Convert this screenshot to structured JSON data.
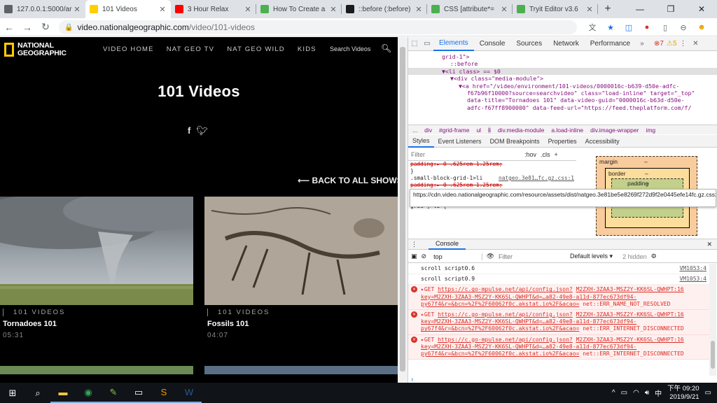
{
  "browser": {
    "tabs": [
      {
        "title": "127.0.0.1:5000/ar",
        "icon": "globe-icon",
        "color": "#5f6368"
      },
      {
        "title": "101 Videos",
        "icon": "natgeo-icon",
        "color": "#ffce00",
        "active": true
      },
      {
        "title": "3 Hour Relax",
        "icon": "youtube-icon",
        "color": "#ff0000"
      },
      {
        "title": "How To Create a",
        "icon": "w3schools-icon",
        "color": "#4caf50"
      },
      {
        "title": "::before (:before)",
        "icon": "mdn-icon",
        "color": "#1a1a1a"
      },
      {
        "title": "CSS [attribute*=",
        "icon": "w3schools-icon",
        "color": "#4caf50"
      },
      {
        "title": "Tryit Editor v3.6",
        "icon": "w3schools-icon",
        "color": "#4caf50"
      }
    ],
    "new_tab_glyph": "+",
    "url_host": "video.nationalgeographic.com",
    "url_path": "/video/101-videos"
  },
  "site": {
    "logo_line1": "NATIONAL",
    "logo_line2": "GEOGRAPHIC",
    "nav": [
      "VIDEO HOME",
      "NAT GEO TV",
      "NAT GEO WILD",
      "KIDS"
    ],
    "search_label": "Search Videos",
    "page_title": "101 Videos",
    "back_link": "BACK TO ALL SHOWS",
    "cards": [
      {
        "label": "101 VIDEOS",
        "title": "Tornadoes 101",
        "duration": "05:31"
      },
      {
        "label": "101 VIDEOS",
        "title": "Fossils 101",
        "duration": "04:07"
      }
    ]
  },
  "devtools": {
    "tabs": [
      "Elements",
      "Console",
      "Sources",
      "Network",
      "Performance"
    ],
    "error_count": "7",
    "warning_count": "5",
    "elements_lines": [
      {
        "indent": 48,
        "text": "grid-1\">"
      },
      {
        "indent": 60,
        "text": "::before"
      },
      {
        "indent": 48,
        "text": "▼<li class> == $0",
        "selected": true
      },
      {
        "indent": 60,
        "text": "▼<div class=\"media-module\">"
      },
      {
        "indent": 72,
        "text": "▼<a href=\"/video/environment/101-videos/0000016c-b639-d50e-adfc-"
      },
      {
        "indent": 84,
        "text": "f67b96f10000?source=searchvideo\" class=\"load-inline\" target=\"_top\""
      },
      {
        "indent": 84,
        "text": "data-title=\"Tornadoes 101\" data-video-guid=\"0000016c-b63d-d50e-"
      },
      {
        "indent": 84,
        "text": "adfc-f67ff8900000\" data-feed-url=\"https://feed.theplatform.com/f/"
      }
    ],
    "breadcrumbs": [
      "...",
      "div",
      "#grid-frame",
      "ul",
      "li",
      "div.media-module",
      "a.load-inline",
      "div.image-wrapper",
      "img"
    ],
    "style_tabs": [
      "Styles",
      "Event Listeners",
      "DOM Breakpoints",
      "Properties",
      "Accessibility"
    ],
    "filter_placeholder": "Filter",
    "hov": ":hov",
    "cls": ".cls",
    "rules": [
      {
        "text": "padding:▸ 0 .625rem 1.25rem;",
        "strike": true
      },
      {
        "text": "}",
        "strike": false
      },
      {
        "text": ".small-block-grid-1>li",
        "src": "natgeo.3e81…fc.gz.css:1"
      },
      {
        "text": "padding:▸ 0 .625rem 1.25rem;",
        "strike": true
      },
      {
        "text": "}",
        "strike": false
      },
      {
        "text": "[class*=block-",
        "src": "natgeo.3e81…fc.gz.css:1"
      },
      {
        "text": "grid-]>li {",
        "strike": false
      }
    ],
    "tooltip": "https://cdn.video.nationalgeographic.com/resource/assets/dist/natgeo.3e81be5e8269f272d9f2e0445efe14fc.gz.css:1",
    "boxmodel": {
      "margin": "margin",
      "border": "border",
      "padding": "padding",
      "content": "42",
      "dash": "–"
    },
    "console_tab": "Console",
    "console_context": "top",
    "console_filter_placeholder": "Filter",
    "levels": "Default levels ▾",
    "hidden": "2 hidden",
    "messages": [
      {
        "type": "log",
        "text": "scroll script0.6",
        "src": "VM1053:4"
      },
      {
        "type": "log",
        "text": "scroll script0.9",
        "src": "VM1053:4"
      },
      {
        "type": "error",
        "method": "▸GET",
        "url": "https://c.go-mpulse.net/api/config.json?",
        "detail": "M2ZXH-3ZAA3-MSZ2Y-KK6SL-QWHPT:16 key=M2ZXH-3ZAA3-MSZ2Y-KK6SL-QWHPT&d=…a82-49e8-a11d-877ec673df94-py67f4&r=&bcn=%2F%2F60062f0c.akstat.io%2F&acao=",
        "status": "net::ERR_NAME_NOT_RESOLVED"
      },
      {
        "type": "error",
        "method": "▸GET",
        "url": "https://c.go-mpulse.net/api/config.json?",
        "detail": "M2ZXH-3ZAA3-MSZ2Y-KK6SL-QWHPT:16 key=M2ZXH-3ZAA3-MSZ2Y-KK6SL-QWHPT&d=…a82-49e8-a11d-877ec673df94-py67f4&r=&bcn=%2F%2F60062f0c.akstat.io%2F&acao=",
        "status": "net::ERR_INTERNET_DISCONNECTED"
      },
      {
        "type": "error",
        "method": "▸GET",
        "url": "https://c.go-mpulse.net/api/config.json?",
        "detail": "M2ZXH-3ZAA3-MSZ2Y-KK6SL-QWHPT:16 key=M2ZXH-3ZAA3-MSZ2Y-KK6SL-QWHPT&d=…a82-49e8-a11d-877ec673df94-py67f4&r=&bcn=%2F%2F60062f0c.akstat.io%2F&acao=",
        "status": "net::ERR_INTERNET_DISCONNECTED"
      }
    ]
  },
  "taskbar": {
    "time": "下午 09:20",
    "date": "2019/9/21",
    "ime": "中"
  }
}
